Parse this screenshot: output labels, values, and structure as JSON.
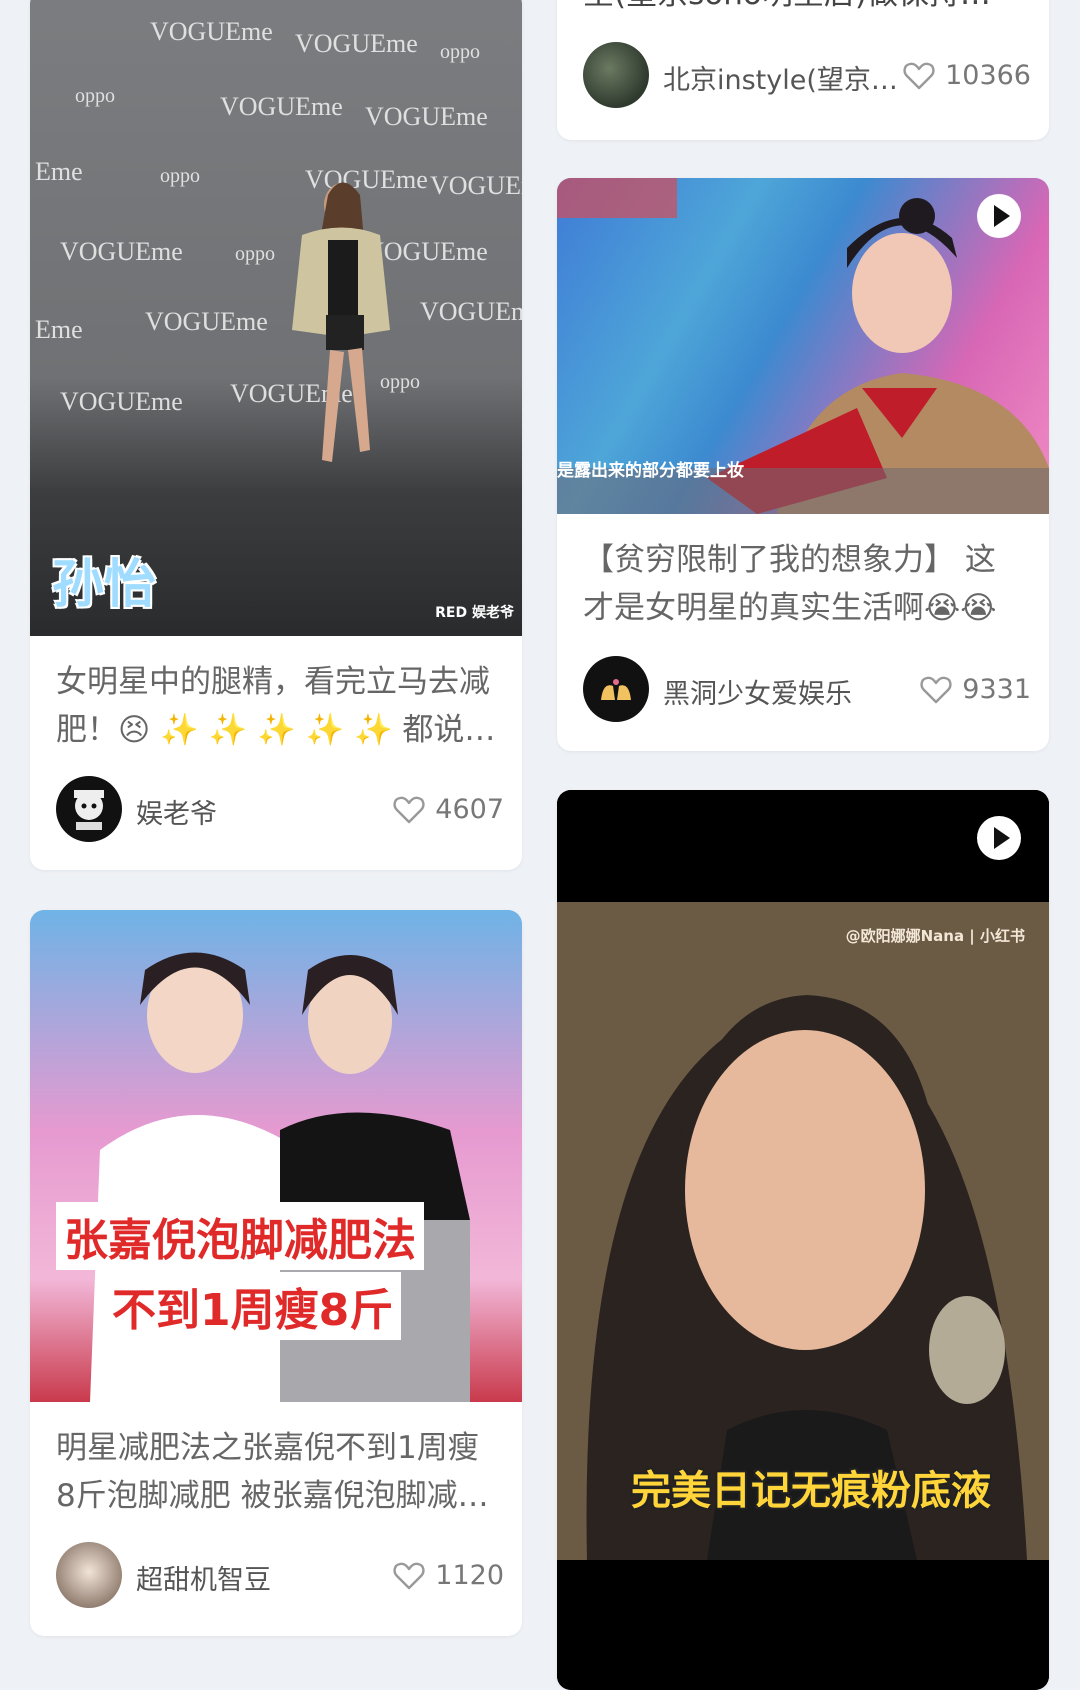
{
  "cards": [
    {
      "title": "星(望京soho明星店)做保持…",
      "author": "北京instyle(望京…",
      "likes": "10366"
    },
    {
      "title": "女明星中的腿精，看完立马去减肥！😣 ✨ ✨ ✨ ✨ ✨ 都说…",
      "author": "娱老爷",
      "likes": "4607",
      "overlay_name": "孙怡",
      "watermark": "RED 娱老爷",
      "backdrop_words": [
        "VOGUEme",
        "oppo"
      ]
    },
    {
      "title": "【贫穷限制了我的想象力】 这才是女明星的真实生活啊😭😭",
      "author": "黑洞少女爱娱乐",
      "likes": "9331",
      "subtitle": "是露出来的部分都要上妆"
    },
    {
      "title": "明星减肥法之张嘉倪不到1周瘦8斤泡脚减肥 被张嘉倪泡脚减…",
      "author": "超甜机智豆",
      "likes": "1120",
      "overlay_line1": "张嘉倪泡脚减肥法",
      "overlay_line2": "不到1周瘦8斤"
    },
    {
      "watermark": "@欧阳娜娜Nana | 小红书",
      "overlay_text": "完美日记无痕粉底液"
    }
  ]
}
